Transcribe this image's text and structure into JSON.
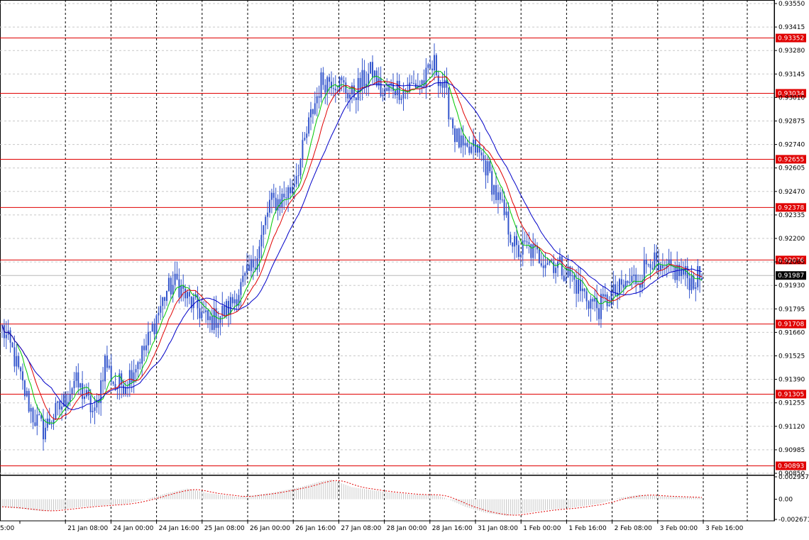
{
  "chart_data": [
    {
      "type": "candlestick",
      "title": "",
      "xlabel": "",
      "ylabel": "",
      "ylim": [
        0.9085,
        0.9355
      ],
      "grid": true,
      "price_ticks": [
        "0.93550",
        "0.93415",
        "0.93280",
        "0.93145",
        "0.93010",
        "0.92875",
        "0.92740",
        "0.92605",
        "0.92470",
        "0.92335",
        "0.92200",
        "0.92065",
        "0.91930",
        "0.91795",
        "0.91660",
        "0.91525",
        "0.91390",
        "0.91255",
        "0.91120",
        "0.90985",
        "0.90850"
      ],
      "time_labels": [
        "5:00",
        "21 Jan 08:00",
        "24 Jan 00:00",
        "24 Jan 16:00",
        "25 Jan 08:00",
        "26 Jan 00:00",
        "26 Jan 16:00",
        "27 Jan 08:00",
        "28 Jan 00:00",
        "28 Jan 16:00",
        "31 Jan 08:00",
        "1 Feb 00:00",
        "1 Feb 16:00",
        "2 Feb 08:00",
        "3 Feb 00:00",
        "3 Feb 16:00"
      ],
      "current_price": "0.91987",
      "levels": [
        "0.93352",
        "0.93034",
        "0.92655",
        "0.92378",
        "0.92076",
        "0.91708",
        "0.91305",
        "0.90893"
      ],
      "close_anchors": [
        [
          0,
          0.9168
        ],
        [
          5,
          0.9155
        ],
        [
          10,
          0.9135
        ],
        [
          15,
          0.9118
        ],
        [
          20,
          0.911
        ],
        [
          25,
          0.9118
        ],
        [
          30,
          0.9126
        ],
        [
          35,
          0.9138
        ],
        [
          40,
          0.913
        ],
        [
          45,
          0.9118
        ],
        [
          50,
          0.915
        ],
        [
          55,
          0.9135
        ],
        [
          60,
          0.9138
        ],
        [
          65,
          0.9148
        ],
        [
          70,
          0.9158
        ],
        [
          75,
          0.9175
        ],
        [
          80,
          0.919
        ],
        [
          85,
          0.9195
        ],
        [
          90,
          0.9185
        ],
        [
          95,
          0.918
        ],
        [
          100,
          0.9172
        ],
        [
          105,
          0.9175
        ],
        [
          110,
          0.918
        ],
        [
          115,
          0.919
        ],
        [
          120,
          0.92
        ],
        [
          125,
          0.9215
        ],
        [
          130,
          0.924
        ],
        [
          135,
          0.9242
        ],
        [
          140,
          0.9248
        ],
        [
          145,
          0.9265
        ],
        [
          150,
          0.929
        ],
        [
          155,
          0.931
        ],
        [
          160,
          0.9312
        ],
        [
          165,
          0.9308
        ],
        [
          170,
          0.9302
        ],
        [
          175,
          0.931
        ],
        [
          180,
          0.9316
        ],
        [
          185,
          0.9302
        ],
        [
          190,
          0.9308
        ],
        [
          195,
          0.9305
        ],
        [
          200,
          0.9308
        ],
        [
          205,
          0.931
        ],
        [
          210,
          0.932
        ],
        [
          215,
          0.9305
        ],
        [
          220,
          0.928
        ],
        [
          225,
          0.9268
        ],
        [
          230,
          0.9272
        ],
        [
          235,
          0.9262
        ],
        [
          240,
          0.9245
        ],
        [
          245,
          0.923
        ],
        [
          250,
          0.9212
        ],
        [
          255,
          0.9215
        ],
        [
          260,
          0.921
        ],
        [
          265,
          0.9208
        ],
        [
          270,
          0.9205
        ],
        [
          275,
          0.92
        ],
        [
          280,
          0.9192
        ],
        [
          285,
          0.9185
        ],
        [
          290,
          0.918
        ],
        [
          295,
          0.9186
        ],
        [
          300,
          0.919
        ],
        [
          305,
          0.9195
        ],
        [
          310,
          0.9198
        ],
        [
          315,
          0.921
        ],
        [
          320,
          0.9198
        ],
        [
          325,
          0.9202
        ],
        [
          330,
          0.92
        ],
        [
          335,
          0.9196
        ],
        [
          340,
          0.9198
        ]
      ],
      "series": [
        {
          "name": "",
          "color": "#00c800",
          "values": []
        },
        {
          "name": "",
          "color": "#e00000",
          "values": []
        },
        {
          "name": "",
          "color": "#0000c8",
          "values": []
        }
      ]
    },
    {
      "type": "histogram",
      "title": "",
      "ticks": [
        "0.002957",
        "0.00",
        "-0.002671"
      ],
      "ylim": [
        -0.002671,
        0.002957
      ],
      "anchors": [
        [
          0,
          -0.001
        ],
        [
          20,
          -0.0016
        ],
        [
          40,
          -0.001
        ],
        [
          60,
          -0.0006
        ],
        [
          70,
          0.0
        ],
        [
          80,
          0.0008
        ],
        [
          90,
          0.0014
        ],
        [
          100,
          0.0008
        ],
        [
          115,
          0.0003
        ],
        [
          130,
          0.0008
        ],
        [
          145,
          0.0016
        ],
        [
          155,
          0.0024
        ],
        [
          160,
          0.0026
        ],
        [
          170,
          0.0016
        ],
        [
          185,
          0.001
        ],
        [
          200,
          0.0006
        ],
        [
          210,
          0.0006
        ],
        [
          215,
          0.0002
        ],
        [
          225,
          -0.001
        ],
        [
          235,
          -0.0018
        ],
        [
          245,
          -0.0022
        ],
        [
          255,
          -0.0018
        ],
        [
          265,
          -0.0014
        ],
        [
          275,
          -0.0012
        ],
        [
          290,
          -0.0006
        ],
        [
          300,
          0.0002
        ],
        [
          310,
          0.0006
        ],
        [
          320,
          0.0004
        ],
        [
          330,
          0.0003
        ],
        [
          340,
          0.0002
        ]
      ]
    }
  ],
  "colors": {
    "candle": "#3355cc",
    "level_line": "#e00000",
    "level_label_bg": "#e00000",
    "grid": "#c8c8c8",
    "vertical_grid": "#000000",
    "osma": "#c8c8c8",
    "signal": "#e00000"
  }
}
